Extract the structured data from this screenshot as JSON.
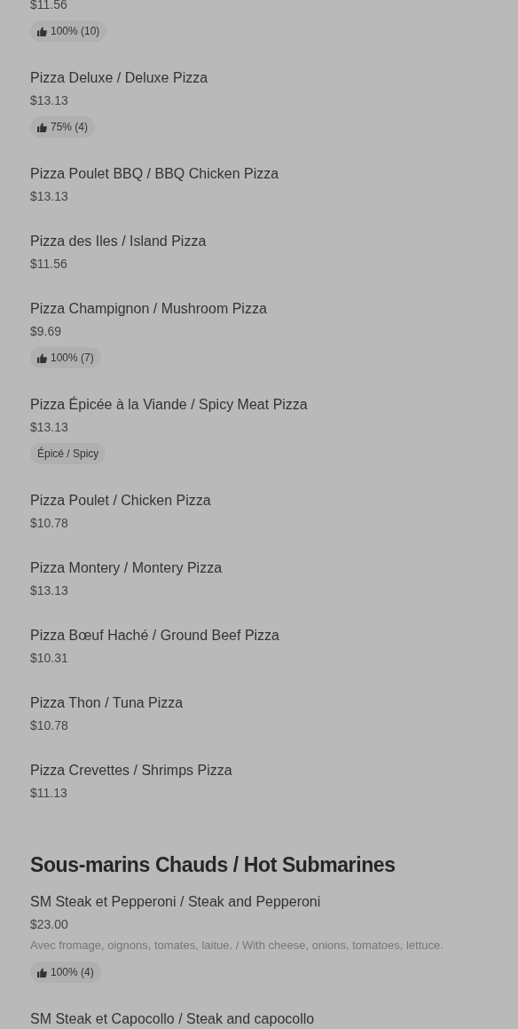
{
  "sections": [
    {
      "items": [
        {
          "price": "$11.56",
          "badge": {
            "kind": "rating",
            "text": "100% (10)"
          }
        },
        {
          "name": "Pizza Deluxe / Deluxe Pizza",
          "price": "$13.13",
          "badge": {
            "kind": "rating",
            "text": "75% (4)"
          }
        },
        {
          "name": "Pizza Poulet BBQ / BBQ Chicken Pizza",
          "price": "$13.13"
        },
        {
          "name": "Pizza des Iles / Island Pizza",
          "price": "$11.56"
        },
        {
          "name": "Pizza Champignon / Mushroom Pizza",
          "price": "$9.69",
          "badge": {
            "kind": "rating",
            "text": "100% (7)"
          }
        },
        {
          "name": "Pizza Épicée à la Viande / Spicy Meat Pizza",
          "price": "$13.13",
          "badge": {
            "kind": "tag",
            "text": "Épicé / Spicy"
          }
        },
        {
          "name": "Pizza Poulet / Chicken Pizza",
          "price": "$10.78"
        },
        {
          "name": "Pizza Montery / Montery Pizza",
          "price": "$13.13"
        },
        {
          "name": "Pizza Bœuf Haché / Ground Beef Pizza",
          "price": "$10.31"
        },
        {
          "name": "Pizza Thon / Tuna Pizza",
          "price": "$10.78"
        },
        {
          "name": "Pizza Crevettes / Shrimps Pizza",
          "price": "$11.13"
        }
      ]
    },
    {
      "title": "Sous-marins Chauds / Hot Submarines",
      "items": [
        {
          "name": "SM Steak et Pepperoni / Steak and Pepperoni",
          "price": "$23.00",
          "description": "Avec fromage, oignons, tomates, laitue. / With cheese, onions, tomatoes, lettuce.",
          "badge": {
            "kind": "rating",
            "text": "100% (4)"
          }
        },
        {
          "name": "SM Steak et Capocollo / Steak and capocollo"
        }
      ]
    }
  ]
}
